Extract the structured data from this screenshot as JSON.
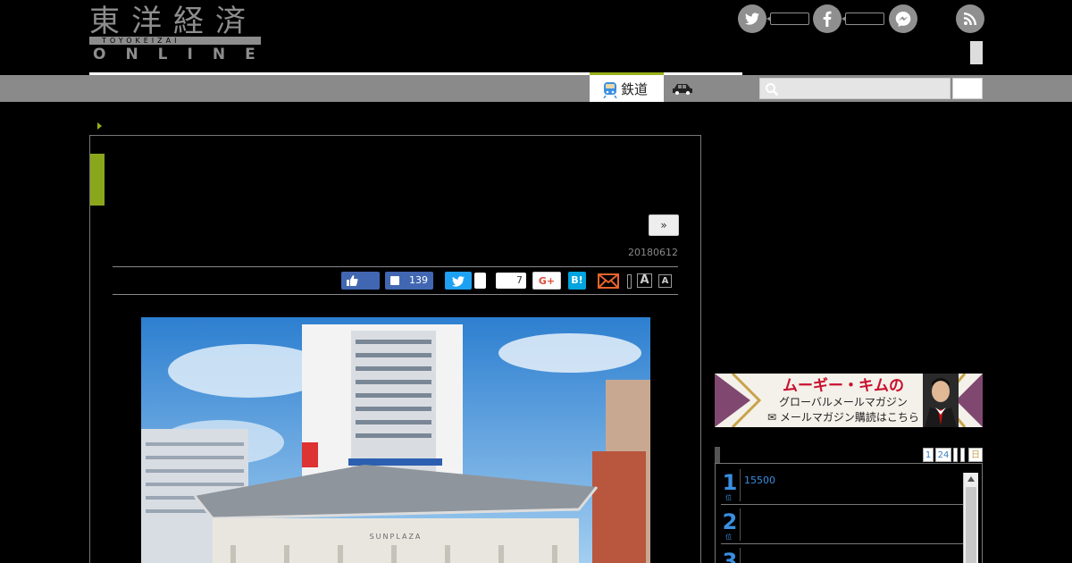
{
  "header": {
    "logo_kanji": "東洋経済",
    "logo_roman": "TOYOKEIZAI",
    "logo_online": "ONLINE"
  },
  "social_header": {
    "icons": [
      "twitter-icon",
      "facebook-icon",
      "messenger-icon",
      "rss-icon"
    ]
  },
  "nav": {
    "active_tab_label": "鉄道",
    "accent_color": "#9ab21a"
  },
  "article": {
    "next_button_label": "»",
    "date": "20180612",
    "share": {
      "facebook_count": "139",
      "hatena_count": "7",
      "gplus_label": "G+",
      "hatena_label": "B!",
      "font_large_label": "A",
      "font_small_label": "A"
    },
    "photo": {
      "sign_text": "SUNPLAZA"
    }
  },
  "sidebar": {
    "banner": {
      "title": "ムーギー・キムの",
      "subtitle": "グローバルメールマガジン",
      "cta": "メールマガジン購読はこちら"
    },
    "ranking": {
      "tabs": [
        "1",
        "24"
      ],
      "tab_last": "日",
      "rows": [
        {
          "rank": "1",
          "unit": "位",
          "text": "15500"
        },
        {
          "rank": "2",
          "unit": "位",
          "text": ""
        },
        {
          "rank": "3",
          "unit": "位",
          "text": ""
        }
      ]
    }
  }
}
